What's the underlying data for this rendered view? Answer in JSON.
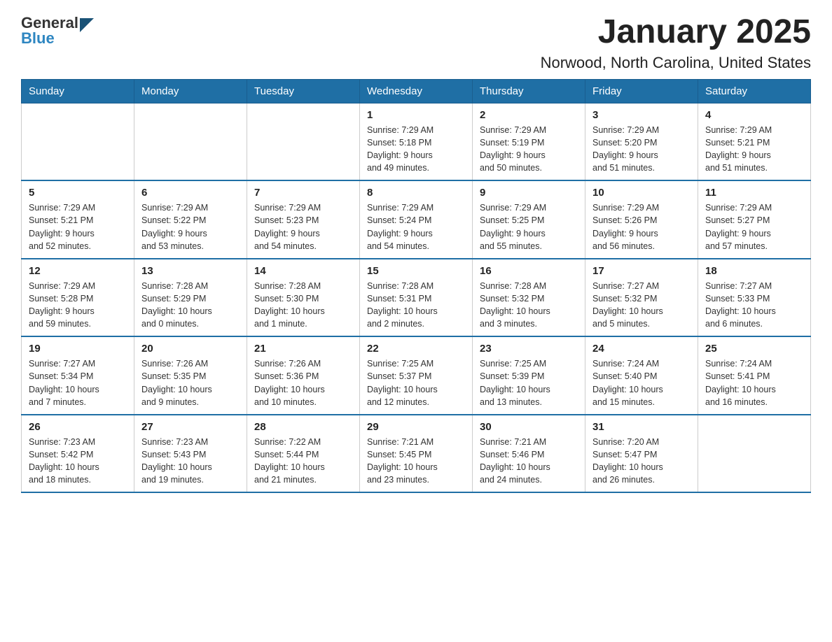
{
  "header": {
    "title": "January 2025",
    "subtitle": "Norwood, North Carolina, United States"
  },
  "logo": {
    "general": "General",
    "blue": "Blue"
  },
  "days": [
    "Sunday",
    "Monday",
    "Tuesday",
    "Wednesday",
    "Thursday",
    "Friday",
    "Saturday"
  ],
  "weeks": [
    [
      {
        "day": "",
        "info": ""
      },
      {
        "day": "",
        "info": ""
      },
      {
        "day": "",
        "info": ""
      },
      {
        "day": "1",
        "info": "Sunrise: 7:29 AM\nSunset: 5:18 PM\nDaylight: 9 hours\nand 49 minutes."
      },
      {
        "day": "2",
        "info": "Sunrise: 7:29 AM\nSunset: 5:19 PM\nDaylight: 9 hours\nand 50 minutes."
      },
      {
        "day": "3",
        "info": "Sunrise: 7:29 AM\nSunset: 5:20 PM\nDaylight: 9 hours\nand 51 minutes."
      },
      {
        "day": "4",
        "info": "Sunrise: 7:29 AM\nSunset: 5:21 PM\nDaylight: 9 hours\nand 51 minutes."
      }
    ],
    [
      {
        "day": "5",
        "info": "Sunrise: 7:29 AM\nSunset: 5:21 PM\nDaylight: 9 hours\nand 52 minutes."
      },
      {
        "day": "6",
        "info": "Sunrise: 7:29 AM\nSunset: 5:22 PM\nDaylight: 9 hours\nand 53 minutes."
      },
      {
        "day": "7",
        "info": "Sunrise: 7:29 AM\nSunset: 5:23 PM\nDaylight: 9 hours\nand 54 minutes."
      },
      {
        "day": "8",
        "info": "Sunrise: 7:29 AM\nSunset: 5:24 PM\nDaylight: 9 hours\nand 54 minutes."
      },
      {
        "day": "9",
        "info": "Sunrise: 7:29 AM\nSunset: 5:25 PM\nDaylight: 9 hours\nand 55 minutes."
      },
      {
        "day": "10",
        "info": "Sunrise: 7:29 AM\nSunset: 5:26 PM\nDaylight: 9 hours\nand 56 minutes."
      },
      {
        "day": "11",
        "info": "Sunrise: 7:29 AM\nSunset: 5:27 PM\nDaylight: 9 hours\nand 57 minutes."
      }
    ],
    [
      {
        "day": "12",
        "info": "Sunrise: 7:29 AM\nSunset: 5:28 PM\nDaylight: 9 hours\nand 59 minutes."
      },
      {
        "day": "13",
        "info": "Sunrise: 7:28 AM\nSunset: 5:29 PM\nDaylight: 10 hours\nand 0 minutes."
      },
      {
        "day": "14",
        "info": "Sunrise: 7:28 AM\nSunset: 5:30 PM\nDaylight: 10 hours\nand 1 minute."
      },
      {
        "day": "15",
        "info": "Sunrise: 7:28 AM\nSunset: 5:31 PM\nDaylight: 10 hours\nand 2 minutes."
      },
      {
        "day": "16",
        "info": "Sunrise: 7:28 AM\nSunset: 5:32 PM\nDaylight: 10 hours\nand 3 minutes."
      },
      {
        "day": "17",
        "info": "Sunrise: 7:27 AM\nSunset: 5:32 PM\nDaylight: 10 hours\nand 5 minutes."
      },
      {
        "day": "18",
        "info": "Sunrise: 7:27 AM\nSunset: 5:33 PM\nDaylight: 10 hours\nand 6 minutes."
      }
    ],
    [
      {
        "day": "19",
        "info": "Sunrise: 7:27 AM\nSunset: 5:34 PM\nDaylight: 10 hours\nand 7 minutes."
      },
      {
        "day": "20",
        "info": "Sunrise: 7:26 AM\nSunset: 5:35 PM\nDaylight: 10 hours\nand 9 minutes."
      },
      {
        "day": "21",
        "info": "Sunrise: 7:26 AM\nSunset: 5:36 PM\nDaylight: 10 hours\nand 10 minutes."
      },
      {
        "day": "22",
        "info": "Sunrise: 7:25 AM\nSunset: 5:37 PM\nDaylight: 10 hours\nand 12 minutes."
      },
      {
        "day": "23",
        "info": "Sunrise: 7:25 AM\nSunset: 5:39 PM\nDaylight: 10 hours\nand 13 minutes."
      },
      {
        "day": "24",
        "info": "Sunrise: 7:24 AM\nSunset: 5:40 PM\nDaylight: 10 hours\nand 15 minutes."
      },
      {
        "day": "25",
        "info": "Sunrise: 7:24 AM\nSunset: 5:41 PM\nDaylight: 10 hours\nand 16 minutes."
      }
    ],
    [
      {
        "day": "26",
        "info": "Sunrise: 7:23 AM\nSunset: 5:42 PM\nDaylight: 10 hours\nand 18 minutes."
      },
      {
        "day": "27",
        "info": "Sunrise: 7:23 AM\nSunset: 5:43 PM\nDaylight: 10 hours\nand 19 minutes."
      },
      {
        "day": "28",
        "info": "Sunrise: 7:22 AM\nSunset: 5:44 PM\nDaylight: 10 hours\nand 21 minutes."
      },
      {
        "day": "29",
        "info": "Sunrise: 7:21 AM\nSunset: 5:45 PM\nDaylight: 10 hours\nand 23 minutes."
      },
      {
        "day": "30",
        "info": "Sunrise: 7:21 AM\nSunset: 5:46 PM\nDaylight: 10 hours\nand 24 minutes."
      },
      {
        "day": "31",
        "info": "Sunrise: 7:20 AM\nSunset: 5:47 PM\nDaylight: 10 hours\nand 26 minutes."
      },
      {
        "day": "",
        "info": ""
      }
    ]
  ]
}
